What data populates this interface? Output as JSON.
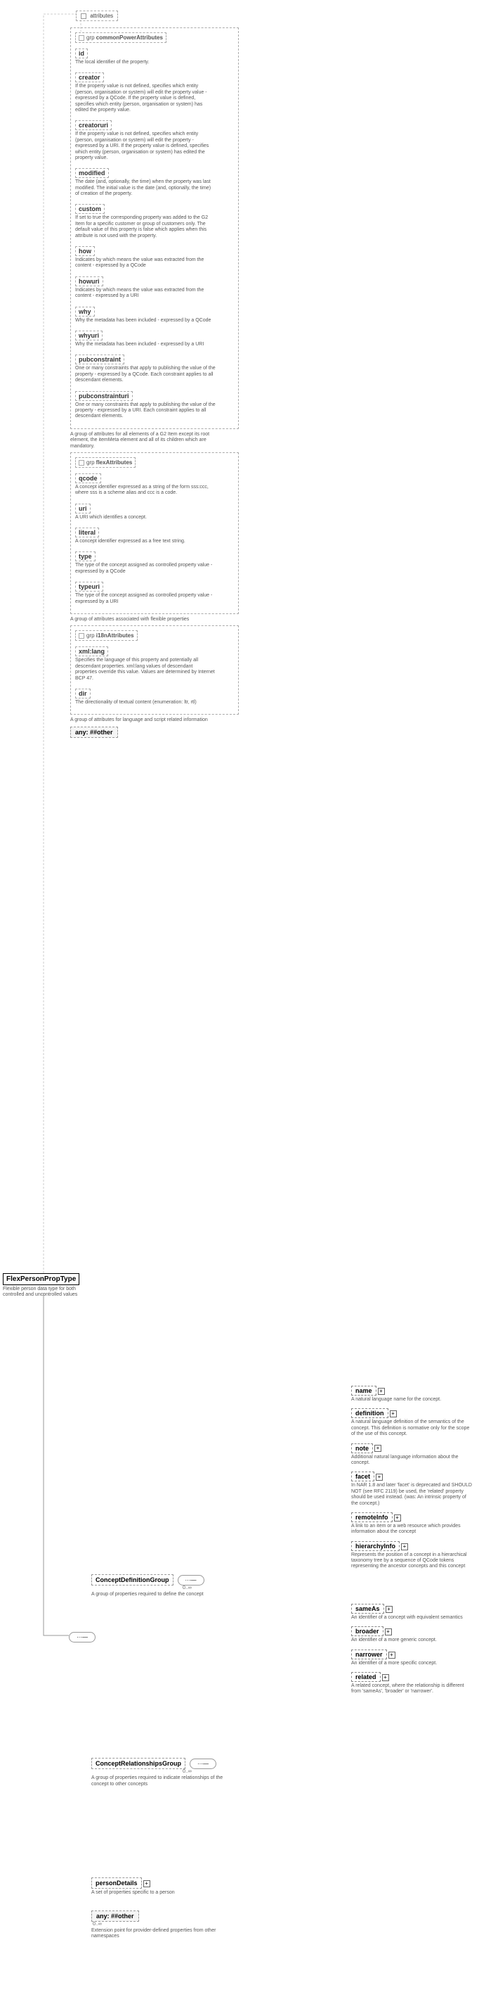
{
  "root": {
    "name": "FlexPersonPropType",
    "desc": "Flexible person data type for both controlled and uncontrolled values"
  },
  "attributes_label": "attributes",
  "groups": [
    {
      "name": "commonPowerAttributes",
      "desc": "A group of attributes for all elements of a G2 Item except its root element, the itemMeta element and all of its children which are mandatory.",
      "attrs": [
        {
          "n": "id",
          "d": "The local identifier of the property."
        },
        {
          "n": "creator",
          "d": "If the property value is not defined, specifies which entity (person, organisation or system) will edit the property value - expressed by a QCode. If the property value is defined, specifies which entity (person, organisation or system) has edited the property value."
        },
        {
          "n": "creatoruri",
          "d": "If the property value is not defined, specifies which entity (person, organisation or system) will edit the property - expressed by a URI. If the property value is defined, specifies which entity (person, organisation or system) has edited the property value."
        },
        {
          "n": "modified",
          "d": "The date (and, optionally, the time) when the property was last modified. The initial value is the date (and, optionally, the time) of creation of the property."
        },
        {
          "n": "custom",
          "d": "If set to true the corresponding property was added to the G2 Item for a specific customer or group of customers only. The default value of this property is false which applies when this attribute is not used with the property."
        },
        {
          "n": "how",
          "d": "Indicates by which means the value was extracted from the content - expressed by a QCode"
        },
        {
          "n": "howuri",
          "d": "Indicates by which means the value was extracted from the content - expressed by a URI"
        },
        {
          "n": "why",
          "d": "Why the metadata has been included - expressed by a QCode"
        },
        {
          "n": "whyuri",
          "d": "Why the metadata has been included - expressed by a URI"
        },
        {
          "n": "pubconstraint",
          "d": "One or many constraints that apply to publishing the value of the property - expressed by a QCode. Each constraint applies to all descendant elements."
        },
        {
          "n": "pubconstrainturi",
          "d": "One or many constraints that apply to publishing the value of the property - expressed by a URI. Each constraint applies to all descendant elements."
        }
      ]
    },
    {
      "name": "flexAttributes",
      "desc": "A group of attributes associated with flexible properties",
      "attrs": [
        {
          "n": "qcode",
          "d": "A concept identifier expressed as a string of the form sss:ccc, where sss is a scheme alias and ccc is a code."
        },
        {
          "n": "uri",
          "d": "A URI which identifies a concept."
        },
        {
          "n": "literal",
          "d": "A concept identifier expressed as a free text string."
        },
        {
          "n": "type",
          "d": "The type of the concept assigned as controlled property value - expressed by a QCode"
        },
        {
          "n": "typeuri",
          "d": "The type of the concept assigned as controlled property value - expressed by a URI"
        }
      ]
    },
    {
      "name": "i18nAttributes",
      "desc": "A group of attributes for language and script related information",
      "attrs": [
        {
          "n": "xml:lang",
          "d": "Specifies the language of this property and potentially all descendant properties. xml:lang values of descendant properties override this value. Values are determined by Internet BCP 47."
        },
        {
          "n": "dir",
          "d": "The directionality of textual content (enumeration: ltr, rtl)"
        }
      ]
    }
  ],
  "other_attr": "##other",
  "any_label": "any:",
  "grp_prefix": "grp",
  "concept_def": {
    "name": "ConceptDefinitionGroup",
    "desc": "A group of properties required to define the concept",
    "card": "0..∞"
  },
  "concept_rel": {
    "name": "ConceptRelationshipsGroup",
    "desc": "A group of properties required to indicate relationships of the concept to other concepts",
    "card": "0..∞"
  },
  "person_details": {
    "name": "personDetails",
    "desc": "A set of properties specific to a person"
  },
  "ext_any": {
    "name": "##other",
    "card": "0..∞",
    "desc": "Extension point for provider-defined properties from other namespaces"
  },
  "def_children": [
    {
      "n": "name",
      "d": "A natural language name for the concept."
    },
    {
      "n": "definition",
      "d": "A natural language definition of the semantics of the concept. This definition is normative only for the scope of the use of this concept."
    },
    {
      "n": "note",
      "d": "Additional natural language information about the concept."
    },
    {
      "n": "facet",
      "d": "In NAR 1.8 and later 'facet' is deprecated and SHOULD NOT (see RFC 2119) be used, the 'related' property should be used instead. (was: An intrinsic property of the concept.)"
    },
    {
      "n": "remoteInfo",
      "d": "A link to an item or a web resource which provides information about the concept"
    },
    {
      "n": "hierarchyInfo",
      "d": "Represents the position of a concept in a hierarchical taxonomy tree by a sequence of QCode tokens representing the ancestor concepts and this concept"
    }
  ],
  "rel_children": [
    {
      "n": "sameAs",
      "d": "An identifier of a concept with equivalent semantics"
    },
    {
      "n": "broader",
      "d": "An identifier of a more generic concept."
    },
    {
      "n": "narrower",
      "d": "An identifier of a more specific concept."
    },
    {
      "n": "related",
      "d": "A related concept, where the relationship is different from 'sameAs', 'broader' or 'narrower'."
    }
  ]
}
